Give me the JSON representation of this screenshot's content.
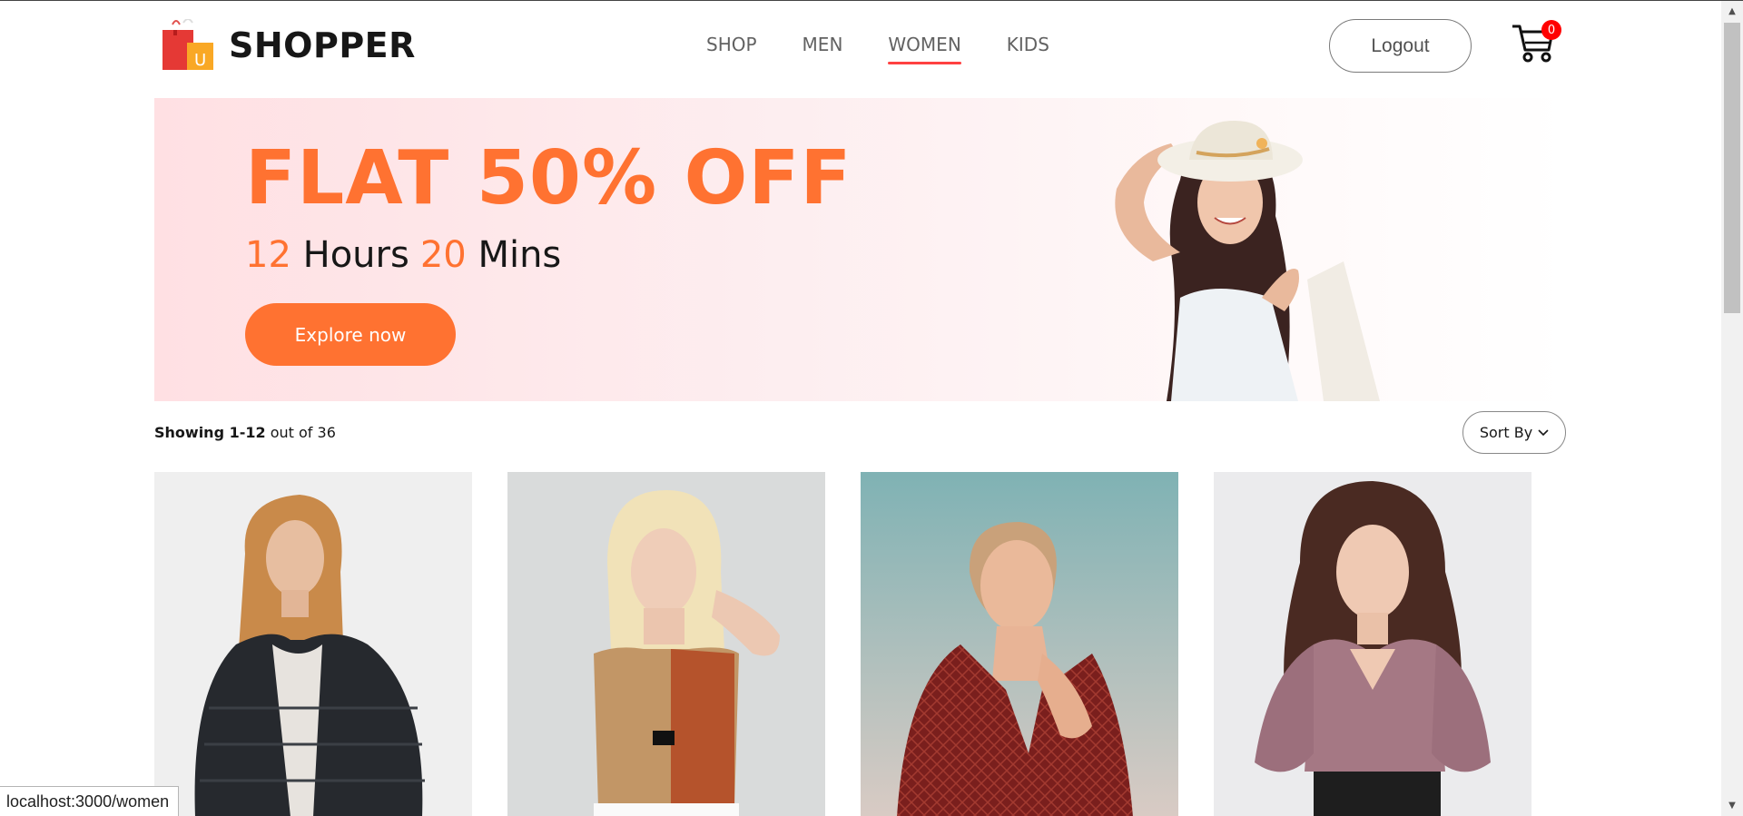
{
  "brand": {
    "name": "SHOPPER"
  },
  "nav": {
    "items": [
      {
        "label": "SHOP",
        "active": false
      },
      {
        "label": "MEN",
        "active": false
      },
      {
        "label": "WOMEN",
        "active": true
      },
      {
        "label": "KIDS",
        "active": false
      }
    ],
    "logout_label": "Logout",
    "cart_count": "0"
  },
  "banner": {
    "title": "FLAT 50% OFF",
    "hours_value": "12",
    "hours_label": "Hours",
    "mins_value": "20",
    "mins_label": "Mins",
    "button_label": "Explore now"
  },
  "listing": {
    "showing_bold": "Showing 1-12",
    "showing_rest": "out of 36",
    "sort_label": "Sort By"
  },
  "products": [
    {
      "icon": "product-image-fur-jacket"
    },
    {
      "icon": "product-image-crop-top"
    },
    {
      "icon": "product-image-wrap-dress"
    },
    {
      "icon": "product-image-puff-sleeve-blouse"
    }
  ],
  "status_bar": {
    "url": "localhost:3000/women"
  },
  "colors": {
    "accent": "#ff7231",
    "nav_underline": "#ff4141",
    "cart_badge": "#ff0000"
  }
}
